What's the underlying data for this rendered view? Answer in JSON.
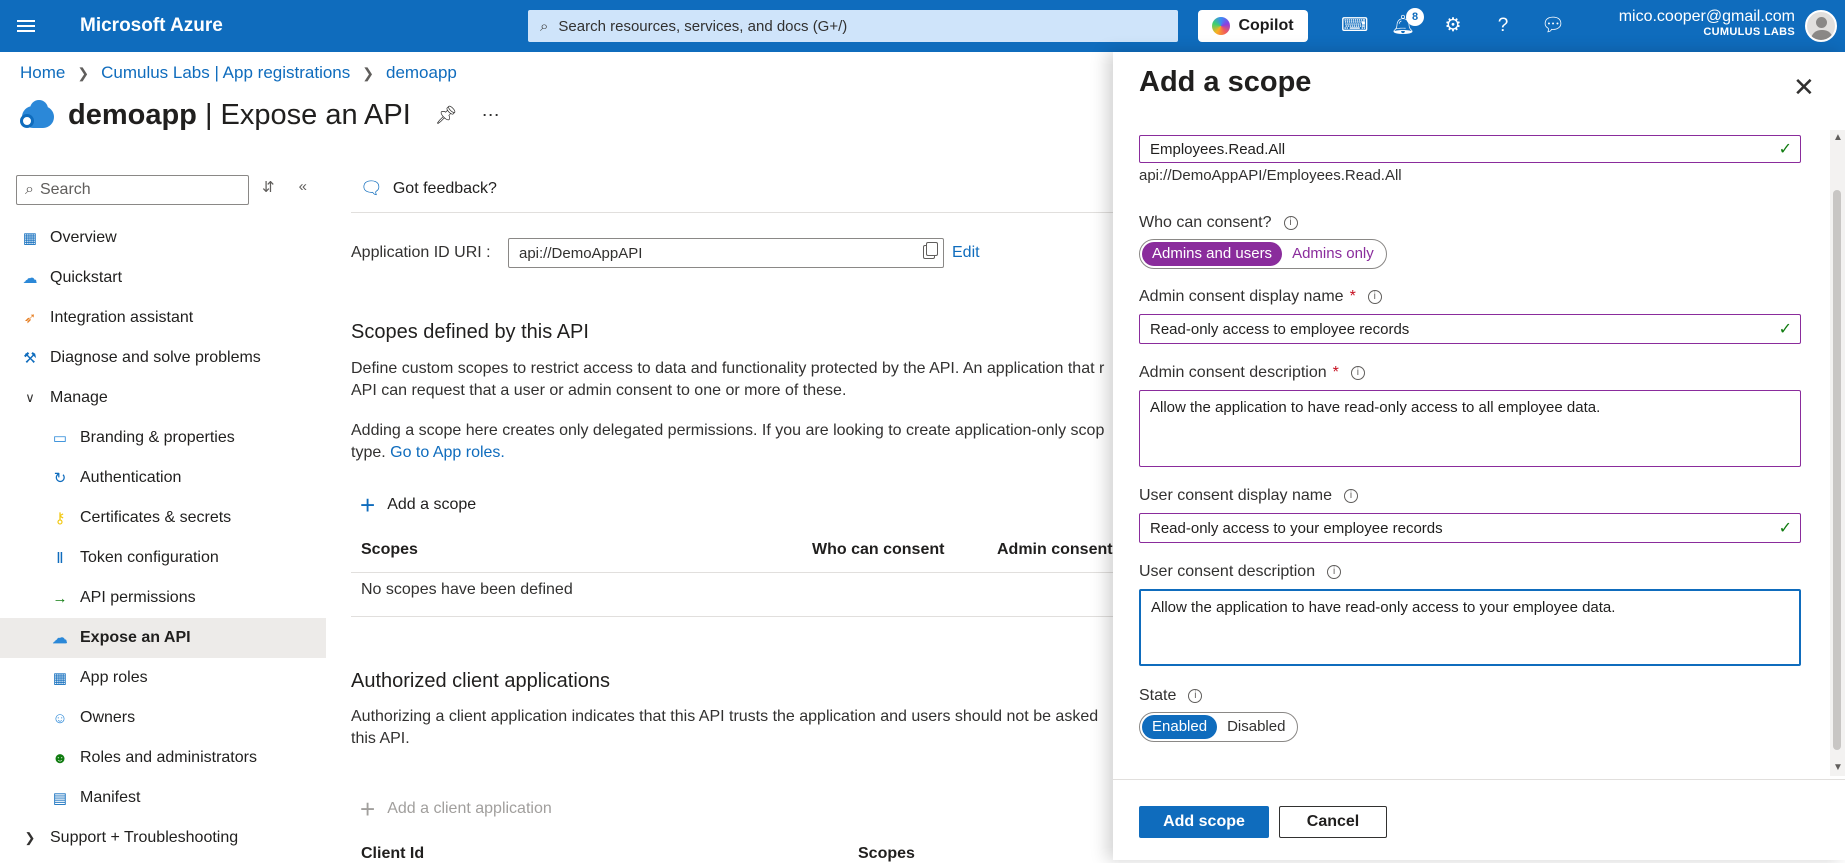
{
  "topbar": {
    "brand": "Microsoft Azure",
    "search_placeholder": "Search resources, services, and docs (G+/)",
    "copilot_label": "Copilot",
    "notification_count": "8",
    "user_email": "mico.cooper@gmail.com",
    "tenant": "CUMULUS LABS"
  },
  "breadcrumb": {
    "home": "Home",
    "parent": "Cumulus Labs | App registrations",
    "current": "demoapp"
  },
  "header": {
    "app_name": "demoapp",
    "page_suffix": " | Expose an API"
  },
  "sidebar": {
    "search_placeholder": "Search",
    "items": [
      {
        "label": "Overview",
        "icon": "overview-icon"
      },
      {
        "label": "Quickstart",
        "icon": "quickstart-icon"
      },
      {
        "label": "Integration assistant",
        "icon": "rocket-icon"
      },
      {
        "label": "Diagnose and solve problems",
        "icon": "wrench-icon"
      },
      {
        "label": "Manage",
        "icon": "chevron-down-icon"
      },
      {
        "label": "Branding & properties",
        "icon": "branding-icon"
      },
      {
        "label": "Authentication",
        "icon": "authentication-icon"
      },
      {
        "label": "Certificates & secrets",
        "icon": "key-icon"
      },
      {
        "label": "Token configuration",
        "icon": "token-icon"
      },
      {
        "label": "API permissions",
        "icon": "api-permissions-icon"
      },
      {
        "label": "Expose an API",
        "icon": "cloud-icon"
      },
      {
        "label": "App roles",
        "icon": "app-roles-icon"
      },
      {
        "label": "Owners",
        "icon": "owners-icon"
      },
      {
        "label": "Roles and administrators",
        "icon": "roles-icon"
      },
      {
        "label": "Manifest",
        "icon": "manifest-icon"
      },
      {
        "label": "Support + Troubleshooting",
        "icon": "chevron-right-icon"
      }
    ]
  },
  "main": {
    "feedback": "Got feedback?",
    "appid_label": "Application ID URI :",
    "appid_value": "api://DemoAppAPI",
    "edit": "Edit",
    "scopes_title": "Scopes defined by this API",
    "scopes_desc": "Define custom scopes to restrict access to data and functionality protected by the API. An application that r\nAPI can request that a user or admin consent to one or more of these.",
    "scopes_note_1": "Adding a scope here creates only delegated permissions. If you are looking to create application-only scop",
    "scopes_note_2": "type. ",
    "scopes_note_link": "Go to App roles.",
    "add_scope": "Add a scope",
    "col_scopes": "Scopes",
    "col_who": "Who can consent",
    "col_admin": "Admin consent d",
    "no_scopes": "No scopes have been defined",
    "clients_title": "Authorized client applications",
    "clients_desc": "Authorizing a client application indicates that this API trusts the application and users should not be asked\nthis API.",
    "add_client": "Add a client application",
    "col_client": "Client Id",
    "col_client_scopes": "Scopes"
  },
  "panel": {
    "title": "Add a scope",
    "scope_name": "Employees.Read.All",
    "scope_full": "api://DemoAppAPI/Employees.Read.All",
    "who_label": "Who can consent?",
    "who_options": [
      "Admins and users",
      "Admins only"
    ],
    "admin_display_label": "Admin consent display name",
    "admin_display_value": "Read-only access to employee records",
    "admin_desc_label": "Admin consent description",
    "admin_desc_value": "Allow the application to have read-only access to all employee data.",
    "user_display_label": "User consent display name",
    "user_display_value": "Read-only access to your employee records",
    "user_desc_label": "User consent description",
    "user_desc_value": "Allow the application to have read-only access to your employee data.",
    "state_label": "State",
    "state_options": [
      "Enabled",
      "Disabled"
    ],
    "add_button": "Add scope",
    "cancel_button": "Cancel"
  },
  "colors": {
    "azure_blue": "#0f6cbd",
    "purple_accent": "#8a2c9c",
    "valid_green": "#107c10"
  }
}
